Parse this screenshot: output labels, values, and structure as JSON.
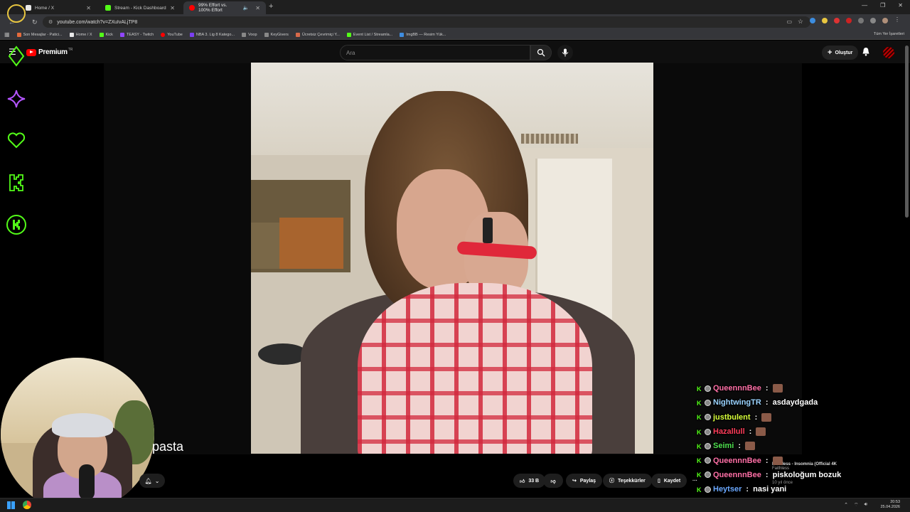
{
  "browser": {
    "tabs": [
      {
        "label": "Home / X",
        "favicon_color": "#e8e8e8"
      },
      {
        "label": "Stream - Kick Dashboard",
        "favicon_color": "#53fc18"
      },
      {
        "label": "99% Effort vs. 100% Effort",
        "favicon_color": "#ff0000"
      }
    ],
    "new_tab": "+",
    "url": "youtube.com/watch?v=ZXuIvALjTP8",
    "bookmarks": [
      {
        "label": "Son Mesajlar - Patici...",
        "color": "#e46b3c"
      },
      {
        "label": "Home / X",
        "color": "#e8e8e8"
      },
      {
        "label": "Kick",
        "color": "#53fc18"
      },
      {
        "label": "TEASY - Twitch",
        "color": "#9146ff"
      },
      {
        "label": "YouTube",
        "color": "#ff0000"
      },
      {
        "label": "NBA 3. Lig 8 Katego...",
        "color": "#7b3ff2"
      },
      {
        "label": "Voop",
        "color": "#888888"
      },
      {
        "label": "KeyGivers",
        "color": "#888888"
      },
      {
        "label": "Ücretsiz Çevrimiçi Y...",
        "color": "#d86a4a"
      },
      {
        "label": "Event List / Streamla...",
        "color": "#53fc18"
      },
      {
        "label": "ImgBB — Resim Yük...",
        "color": "#3f8de0"
      }
    ],
    "bookmarks_right": "Tüm Yer İşaretleri"
  },
  "youtube": {
    "logo_text": "Premium",
    "logo_tr": "TR",
    "search_placeholder": "Ara",
    "create_label": "Oluştur"
  },
  "video_overlay_text": "pasta",
  "actions": {
    "like_count": "33 B",
    "share_label": "Paylaş",
    "thanks_label": "Teşekkürler",
    "save_label": "Kaydet",
    "more": "···"
  },
  "chat": [
    {
      "user": "QueennnBee",
      "color": "#ff6fa6",
      "msg": "",
      "emote": true
    },
    {
      "user": "NightwingTR",
      "color": "#9ad3ff",
      "msg": "asdaydgada",
      "emote": false
    },
    {
      "user": "justbulent",
      "color": "#d7ff3a",
      "msg": "",
      "emote": true
    },
    {
      "user": "Hazallull",
      "color": "#ff3d5a",
      "msg": "",
      "emote": true
    },
    {
      "user": "Seimi",
      "color": "#4fe04f",
      "msg": "",
      "emote": true
    },
    {
      "user": "QueennnBee",
      "color": "#ff6fa6",
      "msg": "",
      "emote": true
    },
    {
      "user": "QueennnBee",
      "color": "#ff6fa6",
      "msg": "piskoloğum bozuk",
      "emote": false
    },
    {
      "user": "Heytser",
      "color": "#6aa8ff",
      "msg": "nasi yani",
      "emote": false
    },
    {
      "user": "QueennnBee",
      "color": "#ff6fa6",
      "msg": "",
      "emote": true
    }
  ],
  "suggested": {
    "title": "Faithless - Insomnia (Official 4K",
    "channel": "Faithless",
    "meta": "10 yıl önce"
  },
  "taskbar": {
    "time": "20:53",
    "date": "25.04.2026"
  },
  "colors": {
    "neon_green": "#53fc18",
    "neon_purple": "#b455ff",
    "yt_red": "#ff0000"
  }
}
